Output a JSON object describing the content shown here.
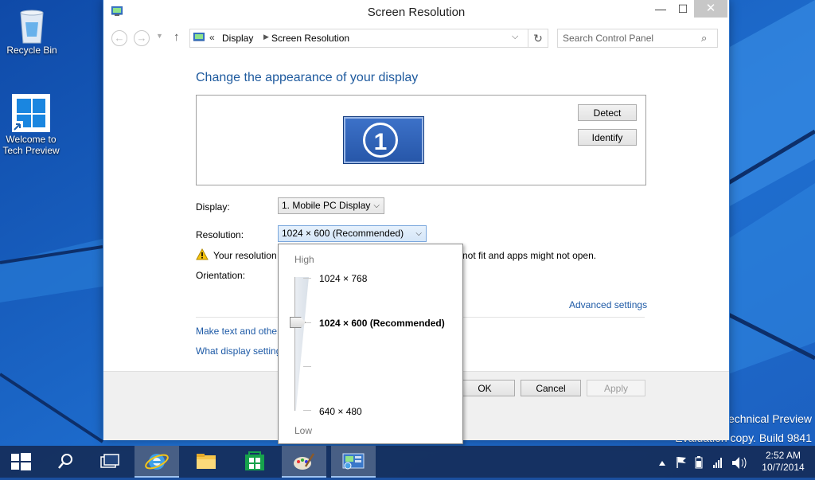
{
  "desktop": {
    "icons": [
      {
        "label": "Recycle Bin"
      },
      {
        "label": "Welcome to Tech Preview"
      }
    ],
    "watermark_line1": "Technical Preview",
    "watermark_line2": "Evaluation copy. Build 9841"
  },
  "window": {
    "title": "Screen Resolution",
    "minimize": "—",
    "maximize": "☐",
    "close": "✕"
  },
  "address": {
    "separator": "«",
    "crumbs": [
      "Display",
      "Screen Resolution"
    ],
    "search_placeholder": "Search Control Panel"
  },
  "content": {
    "heading": "Change the appearance of your display",
    "detect_label": "Detect",
    "identify_label": "Identify",
    "monitor_number": "1",
    "display_label": "Display:",
    "display_value": "1. Mobile PC Display",
    "resolution_label": "Resolution:",
    "resolution_value": "1024 × 600 (Recommended)",
    "warning_text_start": "Your resolution",
    "warning_text_end": "not fit and apps might not open.",
    "orientation_label": "Orientation:",
    "advanced_link": "Advanced settings",
    "link_text_size": "Make text and other",
    "link_display_settings": "What display setting",
    "ok_label": "OK",
    "cancel_label": "Cancel",
    "apply_label": "Apply"
  },
  "resolution_popup": {
    "high_label": "High",
    "low_label": "Low",
    "options": [
      "1024 × 768",
      "1024 × 600 (Recommended)",
      "640 × 480"
    ],
    "selected": "1024 × 600 (Recommended)"
  },
  "taskbar": {
    "clock_time": "2:52 AM",
    "clock_date": "10/7/2014",
    "apps": [
      "start",
      "search",
      "task-view",
      "internet-explorer",
      "file-explorer",
      "store",
      "paint",
      "control-panel"
    ]
  },
  "colors": {
    "link": "#1e5aa6",
    "heading": "#1e5a9e",
    "desktop": "#1a4f9f"
  }
}
